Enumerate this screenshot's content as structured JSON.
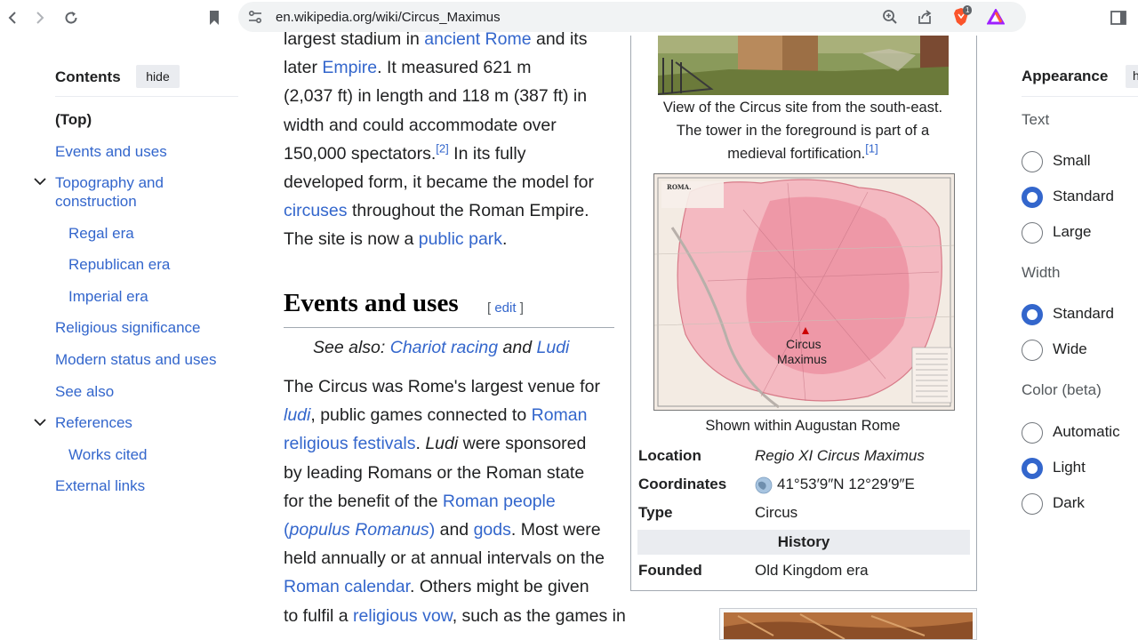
{
  "browser": {
    "url": "en.wikipedia.org/wiki/Circus_Maximus",
    "brave_badge": "1"
  },
  "toc": {
    "title": "Contents",
    "hide": "hide",
    "items": [
      {
        "label": "(Top)"
      },
      {
        "label": "Events and uses"
      },
      {
        "label": "Topography and construction"
      },
      {
        "label": "Regal era"
      },
      {
        "label": "Republican era"
      },
      {
        "label": "Imperial era"
      },
      {
        "label": "Religious significance"
      },
      {
        "label": "Modern status and uses"
      },
      {
        "label": "See also"
      },
      {
        "label": "References"
      },
      {
        "label": "Works cited"
      },
      {
        "label": "External links"
      }
    ]
  },
  "article": {
    "p1": {
      "t1": "largest stadium in ",
      "l1": "ancient Rome",
      "t2": " and its",
      "t3": "later ",
      "l2": "Empire",
      "t4": ". It measured 621 m",
      "t5": "(2,037 ft) in length and 118 m (387 ft) in",
      "t6": "width and could accommodate over",
      "t7": "150,000 spectators.",
      "ref": "[2]",
      "t8": " In its fully",
      "t9": "developed form, it became the model for",
      "l3": "circuses",
      "t10": " throughout the Roman Empire.",
      "t11": "The site is now a ",
      "l4": "public park",
      "t12": "."
    },
    "h2": "Events and uses",
    "edit_open": "[ ",
    "edit": "edit",
    "edit_close": " ]",
    "hatnote": {
      "prefix": "See also: ",
      "l1": "Chariot racing",
      "mid": " and ",
      "l2": "Ludi"
    },
    "p2": {
      "lines": [
        "The Circus was Rome's largest venue for"
      ],
      "l_ludi": "ludi",
      "t_a": ", public games connected to ",
      "l_roman": "Roman",
      "l_relfest": "religious festivals",
      "t_b": ". ",
      "i_ludi": "Ludi",
      "t_c": " were sponsored",
      "t_d": "by leading Romans or the Roman state",
      "t_e": "for the benefit of the ",
      "l_people": "Roman people",
      "l_populus_open": "(",
      "l_populus": "populus Romanus",
      "l_populus_close": ")",
      "t_f": " and ",
      "l_gods": "gods",
      "t_g": ". Most were",
      "t_h": "held annually or at annual intervals on the",
      "l_cal": "Roman calendar",
      "t_i": ". Others might be given",
      "t_j": "to fulfil a ",
      "l_vow": "religious vow",
      "t_k": ", such as the games in"
    }
  },
  "infobox": {
    "caption1_l1": "View of the Circus site from the south-east.",
    "caption1_l2": "The tower in the foreground is part of a",
    "caption1_l3": "medieval fortification.",
    "caption1_ref": "[1]",
    "map_title": "ROMA.",
    "map_label_1": "Circus",
    "map_label_2": "Maximus",
    "map_caption": "Shown within Augustan Rome",
    "rows": [
      {
        "label": "Location",
        "value": "Regio XI Circus Maximus"
      },
      {
        "label": "Coordinates",
        "value": "41°53′9″N 12°29′9″E"
      },
      {
        "label": "Type",
        "value": "Circus"
      }
    ],
    "section": "History",
    "founded_label": "Founded",
    "founded_value": "Old Kingdom era"
  },
  "appearance": {
    "title": "Appearance",
    "hide": "h",
    "groups": [
      {
        "label": "Text",
        "options": [
          {
            "label": "Small",
            "selected": false
          },
          {
            "label": "Standard",
            "selected": true
          },
          {
            "label": "Large",
            "selected": false
          }
        ]
      },
      {
        "label": "Width",
        "options": [
          {
            "label": "Standard",
            "selected": true
          },
          {
            "label": "Wide",
            "selected": false
          }
        ]
      },
      {
        "label": "Color (beta)",
        "options": [
          {
            "label": "Automatic",
            "selected": false
          },
          {
            "label": "Light",
            "selected": true
          },
          {
            "label": "Dark",
            "selected": false
          }
        ]
      }
    ]
  },
  "colors": {
    "link": "#3366cc",
    "accent": "#3366cc"
  }
}
